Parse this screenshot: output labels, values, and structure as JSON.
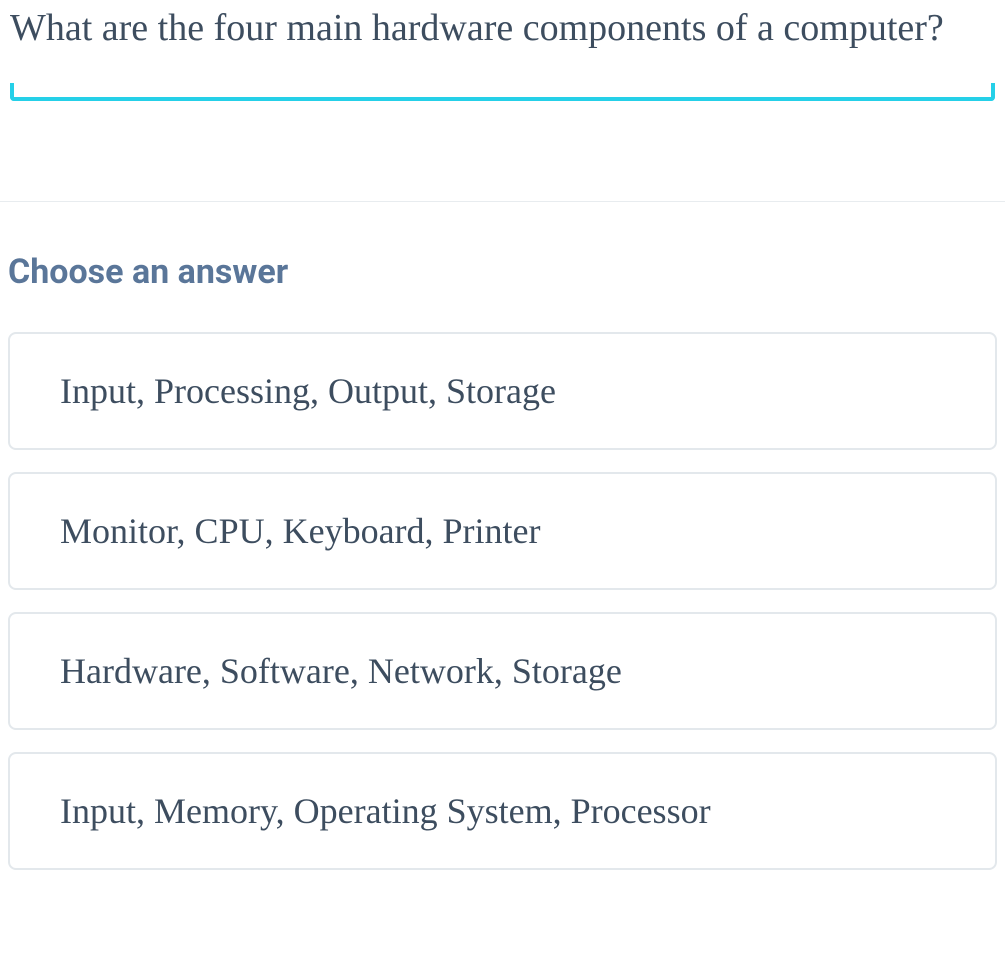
{
  "question": {
    "text": "What are the four main hardware components of a computer?"
  },
  "answer": {
    "heading": "Choose an answer",
    "options": [
      {
        "text": "Input, Processing, Output, Storage"
      },
      {
        "text": " Monitor, CPU, Keyboard, Printer"
      },
      {
        "text": "Hardware, Software, Network, Storage"
      },
      {
        "text": "Input, Memory, Operating System, Processor"
      }
    ]
  }
}
